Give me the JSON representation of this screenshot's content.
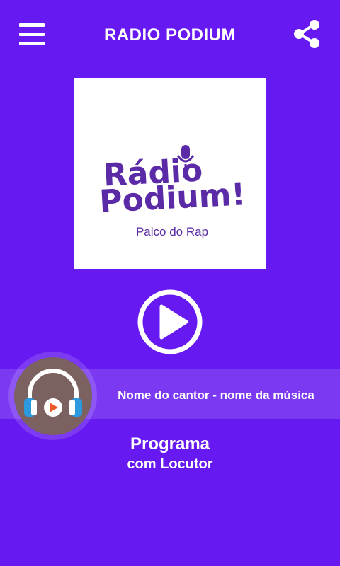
{
  "header": {
    "title": "RADIO PODIUM",
    "menu_icon": "hamburger-menu-icon",
    "share_icon": "share-icon"
  },
  "logo": {
    "line1": "Rádio",
    "line2": "Podium!",
    "tagline": "Palco do Rap",
    "color": "#5b2aa6"
  },
  "player": {
    "play_icon": "play-circle-icon",
    "now_playing": "Nome do cantor - nome da música",
    "cover_icon": "headphones-play-icon"
  },
  "program": {
    "title": "Programa",
    "host": "com Locutor"
  },
  "colors": {
    "background": "#6619f0",
    "band": "rgba(255,255,255,0.14)",
    "disc": "#7b6160",
    "headphone_blue": "#2d9ae0",
    "play_orange": "#ef5a26"
  }
}
